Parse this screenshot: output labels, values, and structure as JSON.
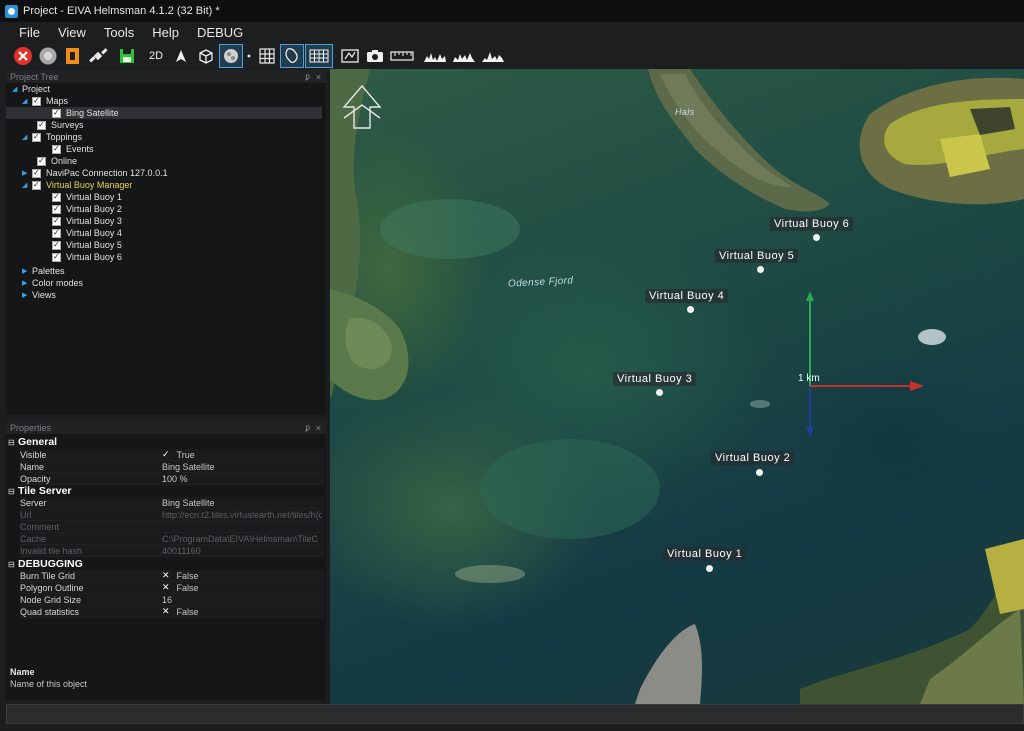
{
  "window": {
    "title": "Project - EIVA Helmsman 4.1.2 (32 Bit) *"
  },
  "menu": [
    "File",
    "View",
    "Tools",
    "Help",
    "DEBUG"
  ],
  "toolbar": {
    "view_2d_label": "2D",
    "icons": [
      "stop-icon",
      "disc-icon",
      "export-icon",
      "satellite-icon",
      "save-icon",
      "view-2d-icon",
      "north-arrow-icon",
      "cube-icon",
      "sphere-icon",
      "grid-icon",
      "map-outline-icon",
      "tile-grid-icon",
      "chart-map-icon",
      "camera-icon",
      "ruler-icon",
      "profile-icon"
    ]
  },
  "project_tree": {
    "header": "Project Tree",
    "pin": "ᵱ",
    "close": "×",
    "items": [
      {
        "label": "Project"
      },
      {
        "label": "Maps"
      },
      {
        "label": "Bing Satellite"
      },
      {
        "label": "Surveys"
      },
      {
        "label": "Toppings"
      },
      {
        "label": "Events"
      },
      {
        "label": "Online"
      },
      {
        "label": "NaviPac Connection 127.0.0.1"
      },
      {
        "label": "Virtual Buoy Manager"
      },
      {
        "label": "Virtual Buoy 1"
      },
      {
        "label": "Virtual Buoy 2"
      },
      {
        "label": "Virtual Buoy 3"
      },
      {
        "label": "Virtual Buoy 4"
      },
      {
        "label": "Virtual Buoy 5"
      },
      {
        "label": "Virtual Buoy 6"
      },
      {
        "label": "Palettes"
      },
      {
        "label": "Color modes"
      },
      {
        "label": "Views"
      }
    ]
  },
  "properties": {
    "header": "Properties",
    "categories": {
      "general": "General",
      "tile_server": "Tile Server",
      "debugging": "DEBUGGING"
    },
    "general": [
      {
        "name": "Visible",
        "value": "True",
        "mark": "✓"
      },
      {
        "name": "Name",
        "value": "Bing Satellite"
      },
      {
        "name": "Opacity",
        "value": "100 %"
      }
    ],
    "tile_server": [
      {
        "name": "Server",
        "value": "Bing Satellite"
      },
      {
        "name": "Url",
        "value": "http://ecn.t2.tiles.virtualearth.net/tiles/h{q"
      },
      {
        "name": "Comment",
        "value": ""
      },
      {
        "name": "Cache",
        "value": "C:\\ProgramData\\EIVA\\Helmsman\\TileC"
      },
      {
        "name": "Invalid tile hash",
        "value": "40011160"
      }
    ],
    "debugging": [
      {
        "name": "Burn Tile Grid",
        "value": "False",
        "mark": "✕"
      },
      {
        "name": "Polygon Outline",
        "value": "False",
        "mark": "✕"
      },
      {
        "name": "Node Grid Size",
        "value": "16"
      },
      {
        "name": "Quad statistics",
        "value": "False",
        "mark": "✕"
      }
    ],
    "description": {
      "name": "Name",
      "text": "Name of this object"
    }
  },
  "map": {
    "place_labels": {
      "hals": "Hals",
      "odense_fjord": "Odense Fjord"
    },
    "scale_label": "1 km",
    "buoys": [
      {
        "label": "Virtual Buoy 1"
      },
      {
        "label": "Virtual Buoy 2"
      },
      {
        "label": "Virtual Buoy 3"
      },
      {
        "label": "Virtual Buoy 4"
      },
      {
        "label": "Virtual Buoy 5"
      },
      {
        "label": "Virtual Buoy 6"
      }
    ]
  }
}
